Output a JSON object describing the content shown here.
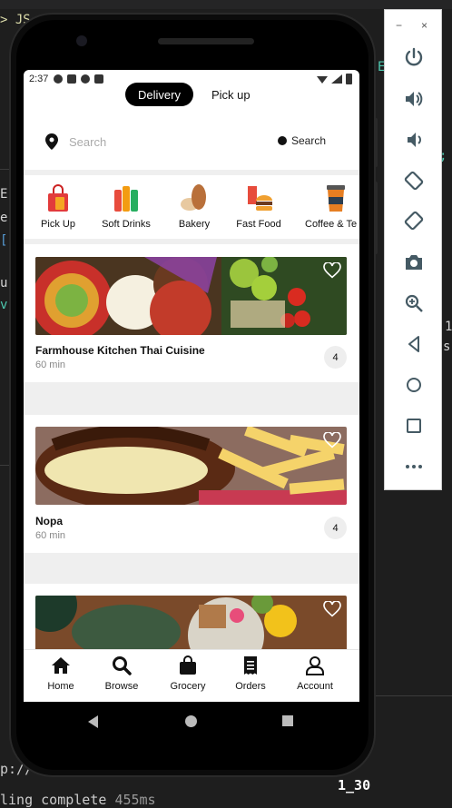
{
  "phone": {
    "status_time": "2:37",
    "toggle": {
      "active": "Delivery",
      "inactive": "Pick up"
    },
    "search": {
      "placeholder": "Search",
      "button_label": "Search"
    },
    "categories": [
      {
        "label": "Pick Up",
        "icon": "shopping-bag-icon"
      },
      {
        "label": "Soft Drinks",
        "icon": "soft-drinks-icon"
      },
      {
        "label": "Bakery",
        "icon": "bread-icon"
      },
      {
        "label": "Fast Food",
        "icon": "burger-icon"
      },
      {
        "label": "Coffee & Te",
        "icon": "coffee-cup-icon"
      }
    ],
    "restaurants": [
      {
        "name": "Farmhouse Kitchen Thai Cuisine",
        "time": "60 min",
        "badge": "4",
        "image": "thai-food-photo"
      },
      {
        "name": "Nopa",
        "time": "60 min",
        "badge": "4",
        "image": "burger-fries-photo"
      },
      {
        "name": "",
        "time": "",
        "badge": "",
        "image": "bowls-photo"
      }
    ],
    "bottom_nav": [
      {
        "label": "Home",
        "icon": "home-icon"
      },
      {
        "label": "Browse",
        "icon": "search-icon"
      },
      {
        "label": "Grocery",
        "icon": "bag-icon"
      },
      {
        "label": "Orders",
        "icon": "receipt-icon"
      },
      {
        "label": "Account",
        "icon": "user-icon"
      }
    ]
  },
  "emulator": {
    "minimize": "−",
    "close": "×",
    "tools": [
      "power-icon",
      "volume-up-icon",
      "volume-down-icon",
      "rotate-left-icon",
      "rotate-right-icon",
      "camera-icon",
      "zoom-icon",
      "back-icon",
      "home-icon",
      "overview-icon",
      "more-icon"
    ]
  },
  "terminal": {
    "line1": "p://",
    "line2": "1_30",
    "line3": "ling complete",
    "line3_time": "455ms"
  }
}
